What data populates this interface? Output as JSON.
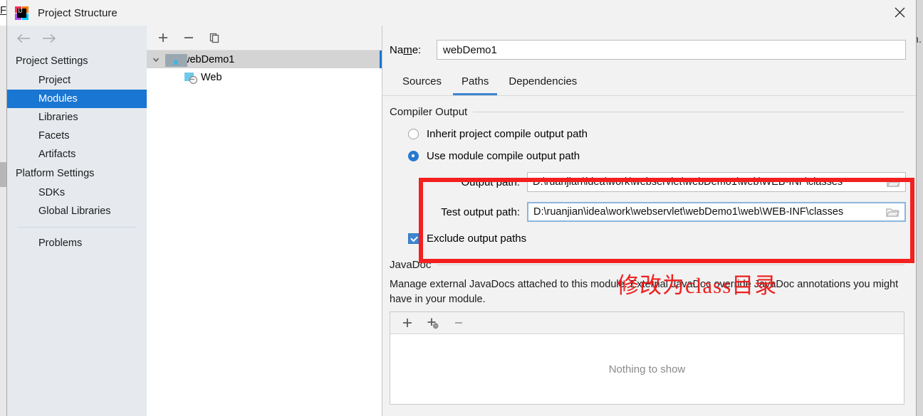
{
  "background": {
    "left_fragment": "F",
    "right_fragment": "n."
  },
  "window": {
    "title": "Project Structure",
    "logo_icon": "intellij-idea-logo-icon",
    "close_icon": "close-icon"
  },
  "nav": {
    "back_icon": "arrow-left-icon",
    "forward_icon": "arrow-right-icon",
    "groups": [
      {
        "label": "Project Settings",
        "items": [
          "Project",
          "Modules",
          "Libraries",
          "Facets",
          "Artifacts"
        ]
      },
      {
        "label": "Platform Settings",
        "items": [
          "SDKs",
          "Global Libraries"
        ]
      }
    ],
    "footer_items": [
      "Problems"
    ],
    "selected": "Modules"
  },
  "tree": {
    "toolbar": [
      {
        "icon": "plus-icon",
        "label": "+"
      },
      {
        "icon": "minus-icon",
        "label": "−"
      },
      {
        "icon": "copy-icon",
        "label": "copy"
      }
    ],
    "nodes": [
      {
        "label": "webDemo1",
        "icon": "module-icon",
        "expanded": true,
        "selected": true
      },
      {
        "label": "Web",
        "icon": "web-facet-icon",
        "expanded": false,
        "selected": false
      }
    ]
  },
  "details": {
    "name_label": "Name:",
    "name_label_mnemonic": "m",
    "name_value": "webDemo1",
    "tabs": [
      {
        "label": "Sources",
        "active": false
      },
      {
        "label": "Paths",
        "active": true
      },
      {
        "label": "Dependencies",
        "active": false
      }
    ],
    "compiler_output": {
      "section_title": "Compiler Output",
      "options": [
        {
          "label": "Inherit project compile output path",
          "selected": false
        },
        {
          "label": "Use module compile output path",
          "selected": true
        }
      ],
      "fields": [
        {
          "label": "Output path:",
          "value": "D:\\ruanjian\\idea\\work\\webservlet\\webDemo1\\web\\WEB-INF\\classes",
          "focused": false,
          "browse_icon": "folder-browse-icon"
        },
        {
          "label": "Test output path:",
          "value": "D:\\ruanjian\\idea\\work\\webservlet\\webDemo1\\web\\WEB-INF\\classes",
          "focused": true,
          "browse_icon": "folder-browse-icon"
        }
      ],
      "exclude_checkbox": {
        "label": "Exclude output paths",
        "checked": true
      }
    },
    "javadoc": {
      "section_title": "JavaDoc",
      "description": "Manage external JavaDocs attached to this module. External JavaDoc override JavaDoc annotations you might have in your module.",
      "toolbar": [
        {
          "icon": "add-icon",
          "label": "+"
        },
        {
          "icon": "add-url-icon",
          "label": "+url"
        },
        {
          "icon": "remove-icon",
          "label": "−"
        }
      ],
      "empty_text": "Nothing to show"
    }
  },
  "annotation": {
    "note_text": "修改为class目录",
    "highlight_color": "#f41f1f",
    "note_color": "#ee2020"
  }
}
